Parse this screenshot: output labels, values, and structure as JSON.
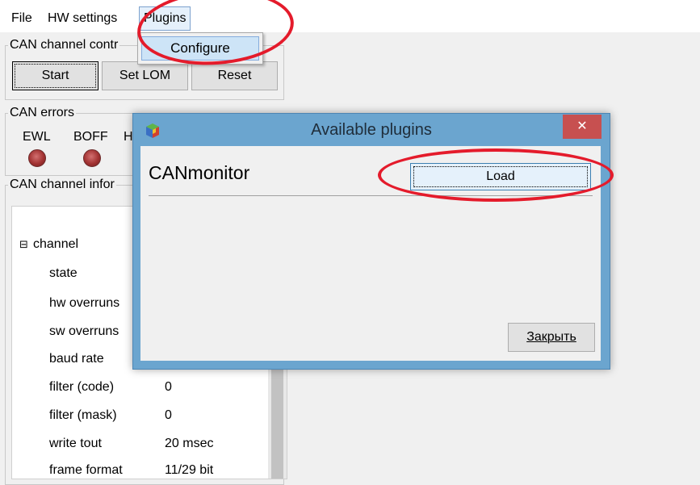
{
  "menubar": {
    "file": "File",
    "hw_settings": "HW settings",
    "plugins": "Plugins",
    "plugins_menu": {
      "configure": "Configure"
    }
  },
  "can_channel_control": {
    "title": "CAN channel contr",
    "start": "Start",
    "set_lom": "Set LOM",
    "reset": "Reset"
  },
  "can_errors": {
    "title": "CAN errors",
    "ewl": "EWL",
    "boff": "BOFF",
    "h_partial": "H"
  },
  "can_channel_info": {
    "title": "CAN channel infor",
    "tree": {
      "root_expander": "⊟",
      "root": "channel",
      "rows": [
        {
          "key": "state",
          "value": ""
        },
        {
          "key": "hw overruns",
          "value": ""
        },
        {
          "key": "sw overruns",
          "value": ""
        },
        {
          "key": "baud rate",
          "value": ""
        },
        {
          "key": "filter (code)",
          "value": "0"
        },
        {
          "key": "filter (mask)",
          "value": "0"
        },
        {
          "key": "write tout",
          "value": "20 msec"
        },
        {
          "key": "frame format",
          "value": "11/29 bit"
        }
      ]
    }
  },
  "dialog": {
    "title": "Available plugins",
    "close_glyph": "✕",
    "plugin_name": "CANmonitor",
    "load": "Load",
    "close_button": "Закрыть",
    "app_icon": "cube-icon"
  },
  "colors": {
    "annotation": "#e41b2b",
    "dialog_frame": "#6ba5cf",
    "close_button": "#c75050",
    "menu_highlight": "#cde4f7"
  }
}
